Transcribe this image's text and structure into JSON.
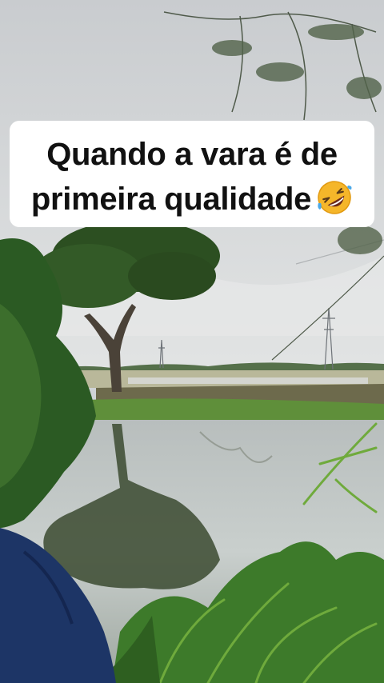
{
  "caption": {
    "line1": "Quando a vara é de",
    "line2": "primeira qualidade",
    "emoji": "rolling-on-floor-laughing-emoji"
  },
  "scene": {
    "sky_color": "#d5d8da",
    "water_color": "#c2c8c8",
    "foliage_color": "#2f5d24",
    "person_shirt_color": "#1d3566"
  }
}
